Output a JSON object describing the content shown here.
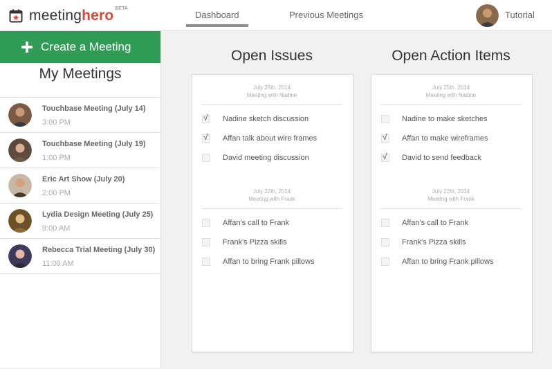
{
  "header": {
    "logo_regular": "meeting",
    "logo_bold": "hero",
    "logo_badge": "BETA",
    "tabs": [
      {
        "label": "Dashboard",
        "active": true
      },
      {
        "label": "Previous Meetings",
        "active": false
      }
    ],
    "tutorial_label": "Tutorial"
  },
  "colors": {
    "accent_green": "#2f9b54",
    "logo_red": "#d5473a"
  },
  "sidebar": {
    "create_label": "Create a Meeting",
    "section_title": "My Meetings",
    "meetings": [
      {
        "title": "Touchbase Meeting (July 14)",
        "time": "3:00 PM"
      },
      {
        "title": "Touchbase Meeting (July 19)",
        "time": "1:00 PM"
      },
      {
        "title": "Eric Art Show (July 20)",
        "time": "2:00 PM"
      },
      {
        "title": "Lydia Design Meeting (July 25)",
        "time": "9:00 AM"
      },
      {
        "title": "Rebecca Trial Meeting (July 30)",
        "time": "11:00 AM"
      }
    ]
  },
  "issues": {
    "title": "Open Issues",
    "groups": [
      {
        "date": "July 25th, 2014",
        "meeting": "Meeting with Nadine",
        "items": [
          {
            "label": "Nadine sketch discussion",
            "checked": true
          },
          {
            "label": "Affan talk about wire frames",
            "checked": true
          },
          {
            "label": "David meeting discussion",
            "checked": false
          }
        ]
      },
      {
        "date": "July 22th, 2014",
        "meeting": "Meeting with Frank",
        "items": [
          {
            "label": "Affan's call to Frank",
            "checked": false
          },
          {
            "label": "Frank's Pizza skills",
            "checked": false
          },
          {
            "label": "Affan to bring Frank pillows",
            "checked": false
          }
        ]
      }
    ]
  },
  "actions": {
    "title": "Open Action Items",
    "groups": [
      {
        "date": "July 25th, 2014",
        "meeting": "Meeting with Nadine",
        "items": [
          {
            "label": "Nadine to make sketches",
            "checked": false
          },
          {
            "label": "Affan to make wireframes",
            "checked": true
          },
          {
            "label": "David to send feedback",
            "checked": true
          }
        ]
      },
      {
        "date": "July 22th, 2014",
        "meeting": "Meeting with Frank",
        "items": [
          {
            "label": "Affan's call to Frank",
            "checked": false
          },
          {
            "label": "Frank's Pizza skills",
            "checked": false
          },
          {
            "label": "Affan to bring Frank pillows",
            "checked": false
          }
        ]
      }
    ]
  }
}
